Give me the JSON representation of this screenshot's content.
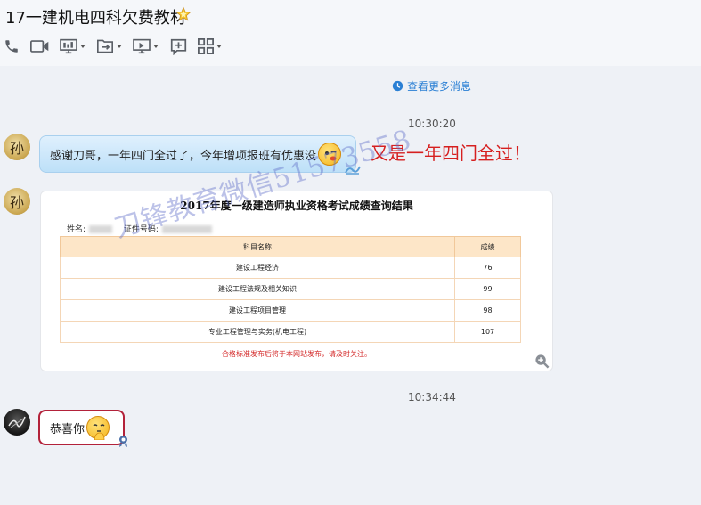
{
  "header": {
    "title": "17一建机电四科欠费教材",
    "star_icon": "star-icon",
    "toolbar": [
      {
        "name": "phone-icon",
        "has_dropdown": false
      },
      {
        "name": "video-call-icon",
        "has_dropdown": false
      },
      {
        "name": "screen-share-icon",
        "has_dropdown": true
      },
      {
        "name": "send-file-icon",
        "has_dropdown": true
      },
      {
        "name": "remote-desktop-icon",
        "has_dropdown": true
      },
      {
        "name": "add-icon",
        "has_dropdown": false
      },
      {
        "name": "apps-icon",
        "has_dropdown": true
      }
    ]
  },
  "chat": {
    "more_messages": "查看更多消息",
    "messages": [
      {
        "time": "10:30:20"
      },
      {
        "sender_avatar_text": "孙",
        "text": "感谢刀哥，一年四门全过了，今年增项报班有优惠没"
      },
      {
        "sender_avatar_text": "孙",
        "type": "image"
      },
      {
        "time": "10:34:44"
      },
      {
        "sender": "self",
        "text": "恭喜你"
      }
    ],
    "annotation": "又是一年四门全过！"
  },
  "result_card": {
    "title": "2017年度一级建造师执业资格考试成绩查询结果",
    "name_label": "姓名:",
    "id_label": "证件号码:",
    "columns": [
      "科目名称",
      "成绩"
    ],
    "rows": [
      {
        "subject": "建设工程经济",
        "score": "76"
      },
      {
        "subject": "建设工程法规及相关知识",
        "score": "99"
      },
      {
        "subject": "建设工程项目管理",
        "score": "98"
      },
      {
        "subject": "专业工程管理与实务(机电工程)",
        "score": "107"
      }
    ],
    "notice": "合格标准发布后将于本网站发布，请及时关注。",
    "watermark": "刀锋教育微信51573558"
  },
  "colors": {
    "annotation": "#d62020",
    "link": "#2a7fd4",
    "bubble_border": "#b3223a",
    "table_header": "#fde6c8"
  }
}
